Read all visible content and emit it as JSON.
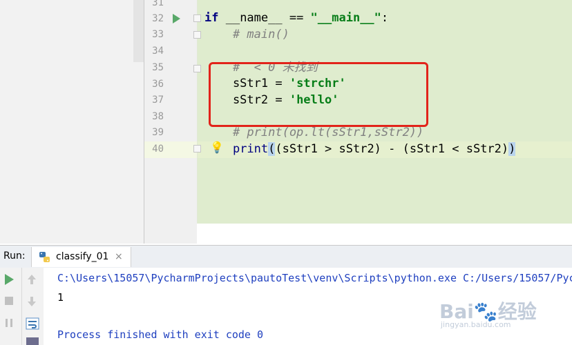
{
  "editor": {
    "lines": [
      {
        "num": "31"
      },
      {
        "num": "32",
        "parts": [
          "if",
          " __name__ == ",
          "\"__main__\"",
          ":"
        ]
      },
      {
        "num": "33",
        "comment": "    # main()"
      },
      {
        "num": "34"
      },
      {
        "num": "35",
        "comment": "    #  < 0 未找到"
      },
      {
        "num": "36",
        "parts": [
          "    sStr1 = ",
          "'strchr'"
        ]
      },
      {
        "num": "37",
        "parts": [
          "    sStr2 = ",
          "'hello'"
        ]
      },
      {
        "num": "38"
      },
      {
        "num": "39",
        "comment": "    # print(op.lt(sStr1,sStr2))"
      },
      {
        "num": "40",
        "parts": [
          "    ",
          "print",
          "(",
          "(sStr1 > sStr2) - (sStr1 < sStr2)",
          ")"
        ]
      }
    ]
  },
  "run_panel": {
    "label": "Run:",
    "tab_name": "classify_01",
    "close": "×"
  },
  "console": {
    "command": "C:\\Users\\15057\\PycharmProjects\\pautoTest\\venv\\Scripts\\python.exe C:/Users/15057/Pyc",
    "output": "1",
    "finished": "Process finished with exit code 0"
  },
  "watermark": {
    "brand": "Bai",
    "brand_suffix": "经验",
    "url": "jingyan.baidu.com"
  },
  "colors": {
    "highlight_green": "#dfecce",
    "annotation_red": "#e2231a",
    "keyword": "#000080",
    "string": "#067d17",
    "comment": "#808080"
  }
}
